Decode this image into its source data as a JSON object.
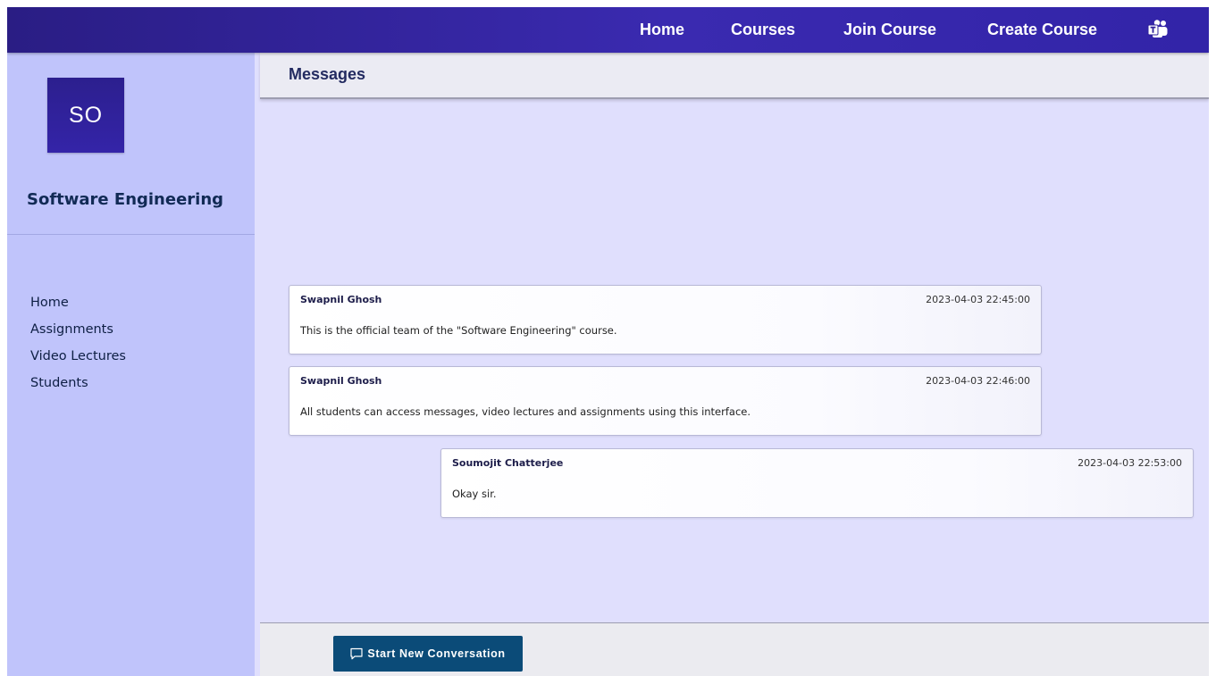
{
  "nav": {
    "home": "Home",
    "courses": "Courses",
    "join_course": "Join Course",
    "create_course": "Create Course",
    "teams_icon": "microsoft-teams-icon"
  },
  "sidebar": {
    "avatar_initials": "SO",
    "course_name": "Software Engineering",
    "items": [
      {
        "label": "Home"
      },
      {
        "label": "Assignments"
      },
      {
        "label": "Video Lectures"
      },
      {
        "label": "Students"
      }
    ]
  },
  "main": {
    "title": "Messages",
    "messages": [
      {
        "sender": "Swapnil Ghosh",
        "timestamp": "2023-04-03  22:45:00",
        "text": "This is the official team of the \"Software Engineering\" course."
      },
      {
        "sender": "Swapnil Ghosh",
        "timestamp": "2023-04-03  22:46:00",
        "text": "All students can access messages, video lectures and assignments using this interface."
      },
      {
        "sender": "Soumojit Chatterjee",
        "timestamp": "2023-04-03  22:53:00",
        "text": "Okay sir."
      }
    ],
    "new_conversation_label": "Start New Conversation",
    "new_conversation_icon": "chat-icon"
  },
  "colors": {
    "nav_bg": "#2e2199",
    "sidebar_bg": "#c0c4fb",
    "main_bg": "#e0dffd",
    "button_bg": "#0b4b78"
  }
}
